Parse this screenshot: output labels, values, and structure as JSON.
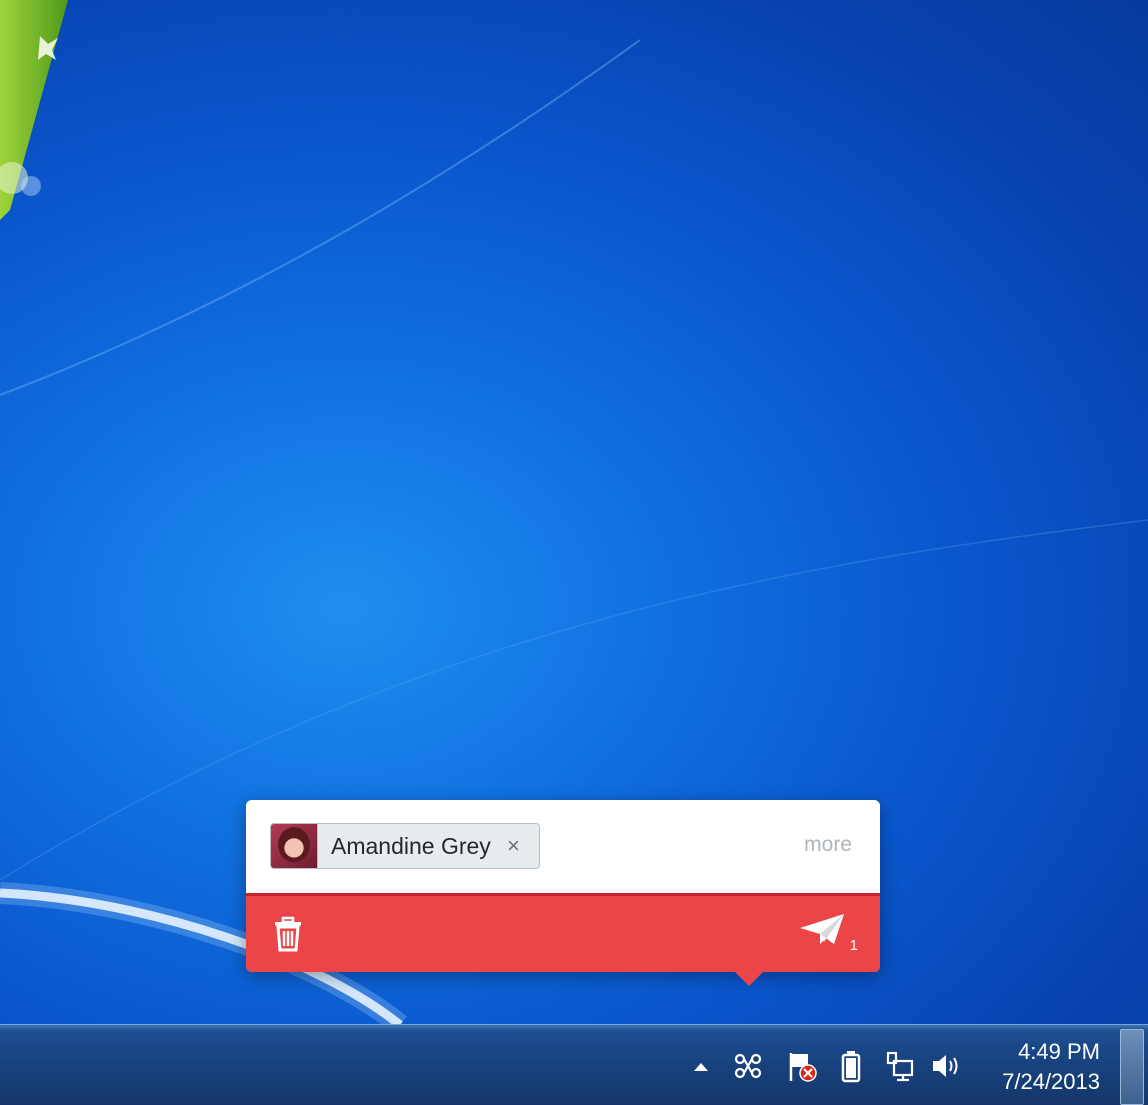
{
  "popup": {
    "recipient": {
      "name": "Amandine Grey",
      "remove_glyph": "×"
    },
    "more_label": "more",
    "trash_icon": "trash-icon",
    "send_icon": "paper-plane-icon",
    "send_count": "1",
    "accent_color": "#ec4547"
  },
  "taskbar": {
    "tray_icons": [
      "chevron-up-icon",
      "command-icon",
      "flag-error-icon",
      "battery-icon",
      "network-icon",
      "speaker-icon"
    ],
    "clock": {
      "time": "4:49 PM",
      "date": "7/24/2013"
    }
  }
}
